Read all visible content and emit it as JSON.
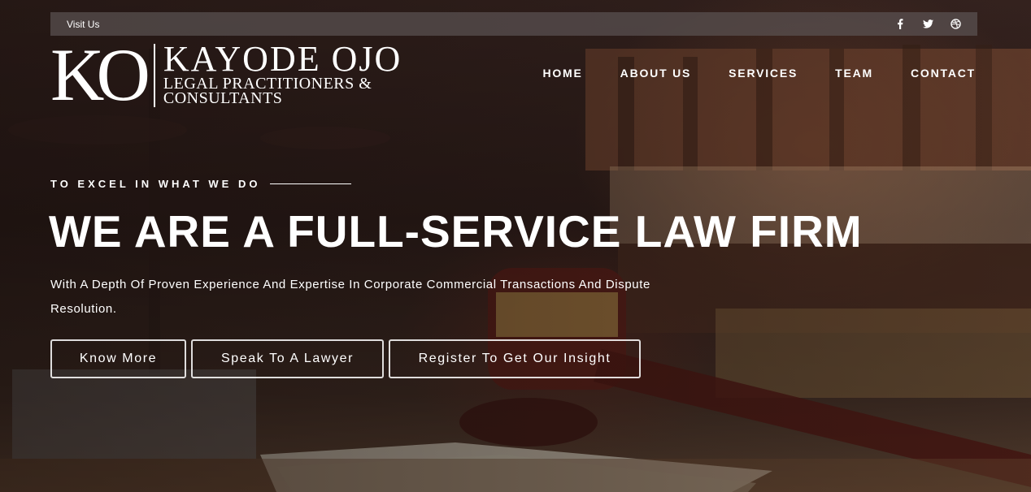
{
  "topbar": {
    "visit_label": "Visit Us",
    "socials": [
      "facebook-icon",
      "twitter-icon",
      "dribbble-icon"
    ],
    "facebook_glyph": "f",
    "twitter_glyph": "🐦",
    "dribbble_glyph": "⊛"
  },
  "logo": {
    "mark": "KO",
    "name": "KAYODE OJO",
    "sub_line1": "LEGAL PRACTITIONERS &",
    "sub_line2": "CONSULTANTS"
  },
  "nav": {
    "items": [
      "HOME",
      "ABOUT US",
      "SERVICES",
      "TEAM",
      "CONTACT"
    ]
  },
  "hero": {
    "tagline": "TO EXCEL IN WHAT WE DO",
    "headline": "WE ARE A FULL-SERVICE LAW FIRM",
    "subtext_line1": "With A Depth Of Proven Experience And Expertise In Corporate Commercial Transactions And Dispute",
    "subtext_line2": "Resolution.",
    "buttons": [
      "Know More",
      "Speak To A Lawyer",
      "Register To Get Our Insight"
    ]
  },
  "colors": {
    "topbar_bg": "#5a5252",
    "text": "#ffffff",
    "accent_wood": "#8c5032"
  }
}
